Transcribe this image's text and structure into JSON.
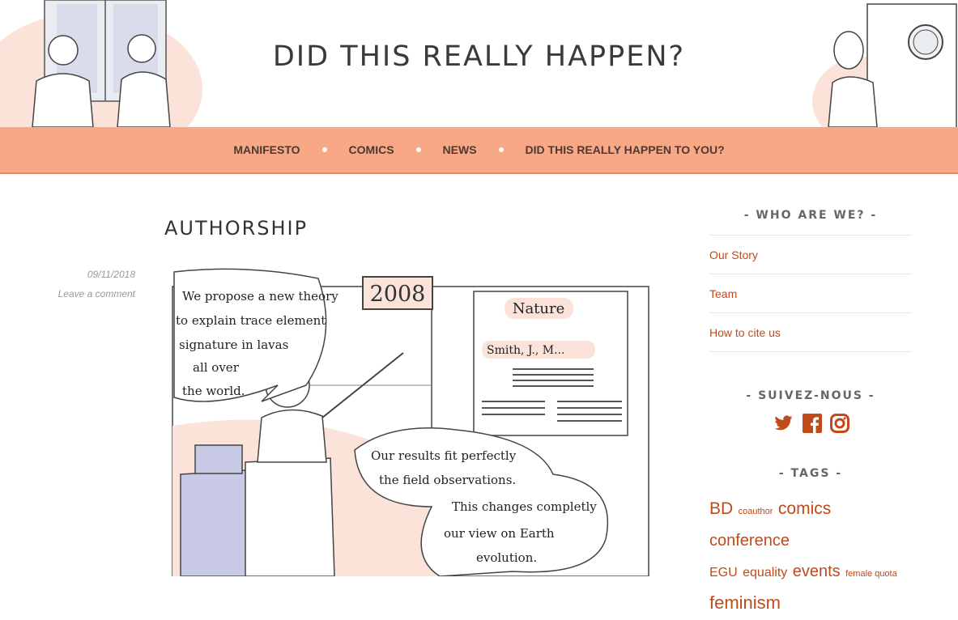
{
  "site": {
    "title": "DID THIS REALLY HAPPEN?"
  },
  "nav": {
    "items": [
      "MANIFESTO",
      "COMICS",
      "NEWS",
      "DID THIS REALLY HAPPEN TO YOU?"
    ]
  },
  "post": {
    "title": "AUTHORSHIP",
    "date": "09/11/2018",
    "comment_link": "Leave a comment"
  },
  "comic": {
    "year": "2008",
    "bubble1": [
      "We propose a new theory",
      "to explain trace element",
      "signature in lavas",
      "all over",
      "the world."
    ],
    "journal": "Nature",
    "author_line": "Smith, J., M...",
    "bubble2": [
      "Our results fit perfectly",
      "the field observations.",
      "This changes completly",
      "our view on Earth",
      "evolution."
    ]
  },
  "sidebar": {
    "who_title": "- WHO ARE WE? -",
    "links": [
      "Our Story",
      "Team",
      "How to cite us"
    ],
    "follow_title": "- SUIVEZ-NOUS -",
    "social_icons": [
      "twitter-icon",
      "facebook-icon",
      "instagram-icon"
    ],
    "tags_title": "- TAGS -",
    "tags": [
      "BD",
      "coauthor",
      "comics",
      "conference",
      "EGU",
      "equality",
      "events",
      "female quota",
      "feminism"
    ]
  },
  "colors": {
    "nav_bg": "#f9a886",
    "accent": "#c04a1a",
    "blush": "#fbe3da",
    "lavender": "#c9cbe6"
  }
}
